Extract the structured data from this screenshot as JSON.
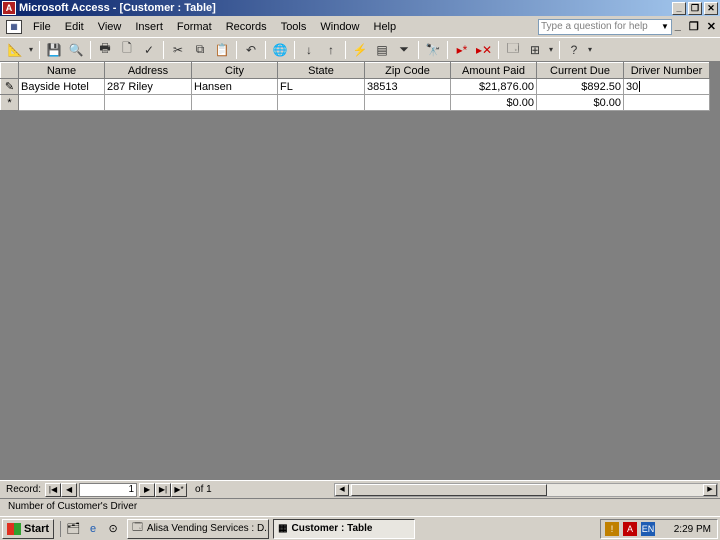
{
  "window": {
    "title": "Microsoft Access - [Customer : Table]",
    "app_icon": "access-icon"
  },
  "menu": {
    "items": [
      "File",
      "Edit",
      "View",
      "Insert",
      "Format",
      "Records",
      "Tools",
      "Window",
      "Help"
    ],
    "ask_placeholder": "Type a question for help"
  },
  "table": {
    "columns": [
      {
        "label": "Name",
        "width": 86
      },
      {
        "label": "Address",
        "width": 87
      },
      {
        "label": "City",
        "width": 86
      },
      {
        "label": "State",
        "width": 87
      },
      {
        "label": "Zip Code",
        "width": 86
      },
      {
        "label": "Amount Paid",
        "width": 86
      },
      {
        "label": "Current Due",
        "width": 87
      },
      {
        "label": "Driver Number",
        "width": 86
      }
    ],
    "rows": [
      {
        "selector": "✎",
        "cells": [
          "Bayside Hotel",
          "287 Riley",
          "Hansen",
          "FL",
          "38513",
          "$21,876.00",
          "$892.50",
          "30"
        ]
      },
      {
        "selector": "*",
        "cells": [
          "",
          "",
          "",
          "",
          "",
          "$0.00",
          "$0.00",
          ""
        ]
      }
    ]
  },
  "nav": {
    "label": "Record:",
    "current": "1",
    "of_text": "of 1"
  },
  "status": {
    "text": "Number of Customer's Driver"
  },
  "taskbar": {
    "start_label": "Start",
    "tasks": [
      {
        "label": "Alisa Vending Services : D..."
      },
      {
        "label": "Customer : Table"
      }
    ],
    "tray_lang": "EN",
    "clock": "2:29 PM"
  }
}
